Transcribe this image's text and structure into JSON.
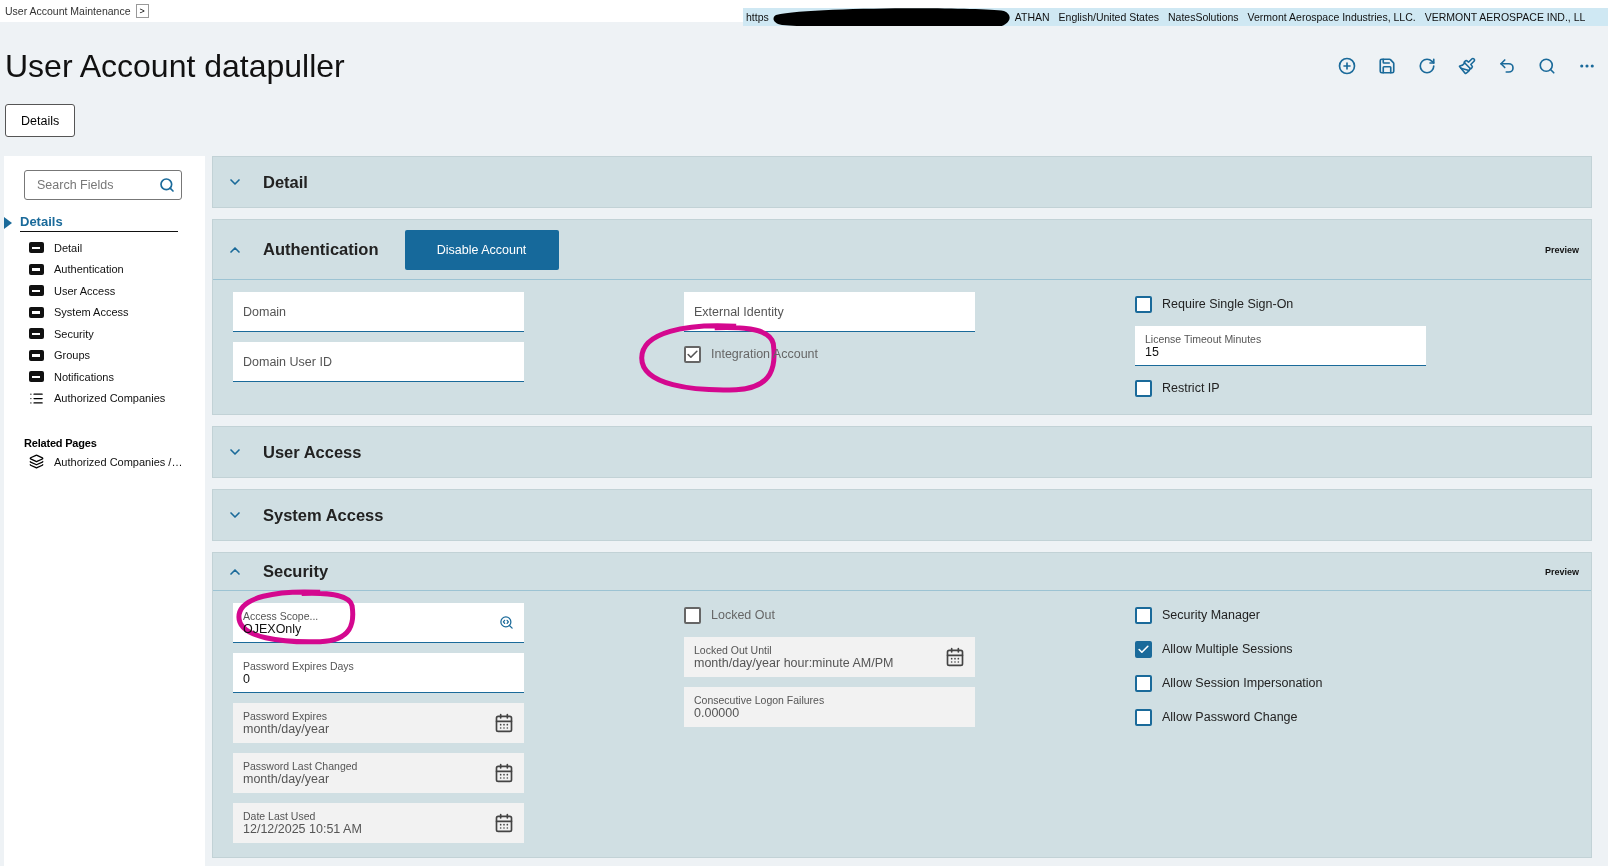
{
  "breadcrumb": {
    "label": "User Account Maintenance",
    "button": ">"
  },
  "header_bar": {
    "url": {
      "text": "https",
      "redacted": true
    },
    "items": [
      "ATHAN",
      "English/United States",
      "NatesSolutions",
      "Vermont Aerospace Industries, LLC.",
      "VERMONT AEROSPACE IND., LL"
    ]
  },
  "title": "User Account datapuller",
  "page_tabs": [
    {
      "label": "Details",
      "selected": true
    }
  ],
  "sidebar": {
    "search": {
      "placeholder": "Search Fields"
    },
    "group": {
      "label": "Details",
      "expanded": true,
      "items": [
        {
          "label": "Detail",
          "kind": "card"
        },
        {
          "label": "Authentication",
          "kind": "card"
        },
        {
          "label": "User Access",
          "kind": "card"
        },
        {
          "label": "System Access",
          "kind": "card"
        },
        {
          "label": "Security",
          "kind": "card"
        },
        {
          "label": "Groups",
          "kind": "card"
        },
        {
          "label": "Notifications",
          "kind": "card"
        },
        {
          "label": "Authorized Companies",
          "kind": "list"
        }
      ]
    },
    "related": {
      "title": "Related Pages",
      "items": [
        {
          "label": "Authorized Companies /…",
          "kind": "pages"
        }
      ]
    }
  },
  "sections": [
    {
      "title": "Detail",
      "expanded": false
    },
    {
      "title": "Authentication",
      "expanded": true,
      "button": "Disable Account",
      "preview": "Preview",
      "columns": [
        [
          {
            "kind": "field",
            "label": "Domain"
          },
          {
            "kind": "field",
            "label": "Domain User ID"
          }
        ],
        [
          {
            "kind": "field",
            "label": "External Identity"
          },
          {
            "kind": "checkbox",
            "label": "Integration Account",
            "checked": true,
            "disabled": true,
            "annotated": true
          }
        ],
        [
          {
            "kind": "checkbox",
            "label": "Require Single Sign-On",
            "checked": false,
            "disabled": false
          },
          {
            "kind": "field",
            "label": "License Timeout Minutes",
            "value": "15"
          },
          {
            "kind": "checkbox",
            "label": "Restrict IP",
            "checked": false,
            "disabled": false
          }
        ]
      ]
    },
    {
      "title": "User Access",
      "expanded": false
    },
    {
      "title": "System Access",
      "expanded": false
    },
    {
      "title": "Security",
      "expanded": true,
      "preview": "Preview",
      "columns": [
        [
          {
            "kind": "lookup",
            "label": "Access Scope...",
            "value": "OJEXOnly",
            "annotated": true
          },
          {
            "kind": "field",
            "label": "Password Expires Days",
            "value": "0"
          },
          {
            "kind": "date",
            "label": "Password Expires",
            "value": "month/day/year",
            "readonly": true
          },
          {
            "kind": "date",
            "label": "Password Last Changed",
            "value": "month/day/year",
            "readonly": true
          },
          {
            "kind": "date",
            "label": "Date Last Used",
            "value": "12/12/2025 10:51 AM",
            "readonly": true
          }
        ],
        [
          {
            "kind": "checkbox",
            "label": "Locked Out",
            "checked": false,
            "disabled": true
          },
          {
            "kind": "date",
            "label": "Locked Out Until",
            "value": "month/day/year hour:minute AM/PM",
            "readonly": true
          },
          {
            "kind": "field",
            "label": "Consecutive Logon Failures",
            "value": "0.00000",
            "readonly": true
          }
        ],
        [
          {
            "kind": "checkbox",
            "label": "Security Manager",
            "checked": false,
            "disabled": false
          },
          {
            "kind": "checkbox",
            "label": "Allow Multiple Sessions",
            "checked": true,
            "disabled": false
          },
          {
            "kind": "checkbox",
            "label": "Allow Session Impersonation",
            "checked": false,
            "disabled": false
          },
          {
            "kind": "checkbox",
            "label": "Allow Password Change",
            "checked": false,
            "disabled": false
          }
        ]
      ]
    }
  ]
}
